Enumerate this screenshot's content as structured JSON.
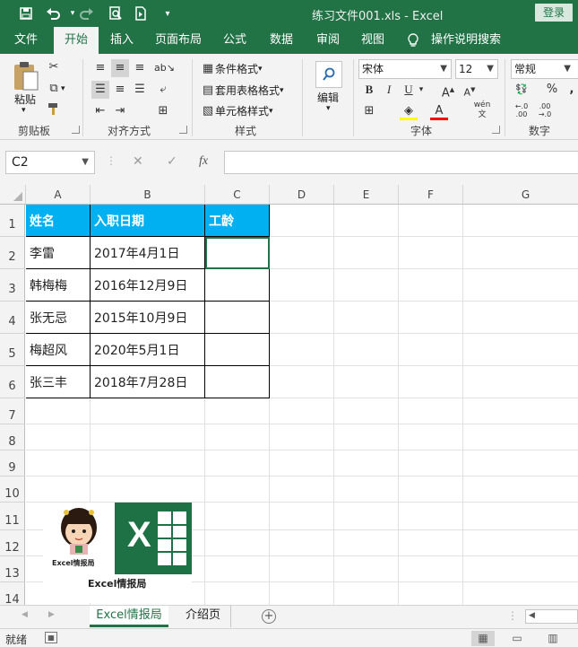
{
  "titlebar": {
    "title": "练习文件001.xls - Excel",
    "login": "登录",
    "icons": [
      "save-icon",
      "undo-icon",
      "redo-icon",
      "print-preview-icon",
      "touch-mode-icon",
      "customize-qat-icon"
    ]
  },
  "tabs": [
    "文件",
    "开始",
    "插入",
    "页面布局",
    "公式",
    "数据",
    "审阅",
    "视图"
  ],
  "active_tab": "开始",
  "tell_me": "操作说明搜索",
  "ribbon": {
    "clipboard": {
      "label": "剪贴板",
      "paste": "粘贴"
    },
    "alignment": {
      "label": "对齐方式"
    },
    "styles": {
      "label": "样式",
      "conditional": "条件格式",
      "table": "套用表格格式",
      "cell": "单元格样式"
    },
    "editing": {
      "label": "编辑"
    },
    "font": {
      "label": "字体",
      "name": "宋体",
      "size": "12",
      "bold": "B",
      "italic": "I",
      "underline": "U",
      "wen": "wén"
    },
    "number": {
      "label": "数字",
      "format": "常规",
      "percent": "%",
      "comma": ","
    }
  },
  "formula_bar": {
    "name_box": "C2",
    "fx": "fx",
    "value": ""
  },
  "columns": [
    "A",
    "B",
    "C",
    "D",
    "E",
    "F",
    "G"
  ],
  "rows": [
    "1",
    "2",
    "3",
    "4",
    "5",
    "6",
    "7",
    "8",
    "9",
    "10",
    "11",
    "12",
    "13",
    "14"
  ],
  "table": {
    "headers": [
      "姓名",
      "入职日期",
      "工龄"
    ],
    "rows": [
      [
        "李雷",
        "2017年4月1日",
        ""
      ],
      [
        "韩梅梅",
        "2016年12月9日",
        ""
      ],
      [
        "张无忌",
        "2015年10月9日",
        ""
      ],
      [
        "梅超风",
        "2020年5月1日",
        ""
      ],
      [
        "张三丰",
        "2018年7月28日",
        ""
      ]
    ]
  },
  "selected_cell": "C2",
  "logo": {
    "caption_small": "Excel情报局",
    "caption": "Excel情报局",
    "mark": "X"
  },
  "sheets": [
    "Excel情报局",
    "介绍页"
  ],
  "active_sheet": "Excel情报局",
  "status": "就绪",
  "colors": {
    "accent": "#217346",
    "header_fill": "#00b0f0"
  }
}
